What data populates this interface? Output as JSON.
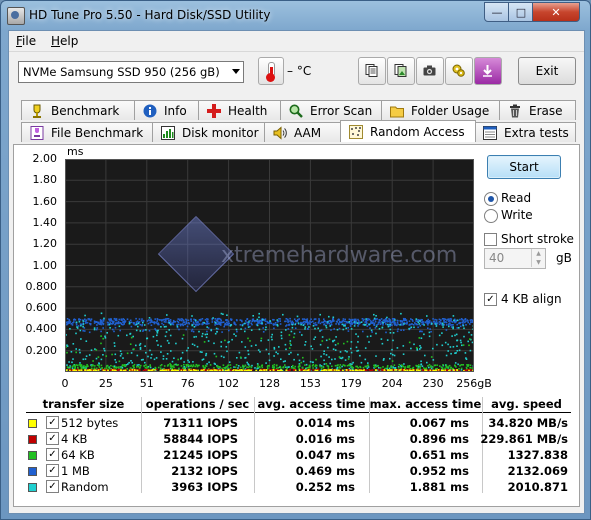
{
  "window": {
    "title": "HD Tune Pro 5.50 - Hard Disk/SSD Utility"
  },
  "menu": [
    {
      "label": "File",
      "underline": "F",
      "rest": "ile"
    },
    {
      "label": "Help",
      "underline": "H",
      "rest": "elp"
    }
  ],
  "toolbar": {
    "drive": "NVMe    Samsung SSD 950 (256 gB)",
    "temperature": "– °C",
    "exit_label": "Exit",
    "buttons": [
      "copy-text-icon",
      "copy-screenshot-icon",
      "camera-icon",
      "options-icon",
      "save-icon"
    ]
  },
  "tabs_row1": [
    "Benchmark",
    "Info",
    "Health",
    "Error Scan",
    "Folder Usage",
    "Erase"
  ],
  "tabs_row2": [
    "File Benchmark",
    "Disk monitor",
    "AAM",
    "Random Access",
    "Extra tests"
  ],
  "active_tab": "Random Access",
  "graph": {
    "y_unit": "ms",
    "y_ticks": [
      "2.00",
      "1.80",
      "1.60",
      "1.40",
      "1.20",
      "1.00",
      "0.800",
      "0.600",
      "0.400",
      "0.200"
    ],
    "x_ticks": [
      "0",
      "25",
      "51",
      "76",
      "102",
      "128",
      "153",
      "179",
      "204",
      "230",
      "256gB"
    ],
    "watermark": "xtremehardware.com"
  },
  "controls": {
    "start_label": "Start",
    "read_label": "Read",
    "write_label": "Write",
    "short_stroke_label": "Short stroke",
    "short_stroke_value": "40",
    "short_stroke_unit": "gB",
    "align_label": "4 KB align",
    "read_selected": true,
    "short_stroke_checked": false,
    "align_checked": true
  },
  "results": {
    "headers": [
      "transfer size",
      "operations / sec",
      "avg. access time",
      "max. access time",
      "avg. speed"
    ],
    "rows": [
      {
        "size": "512 bytes",
        "color": "#ffff00",
        "ops": "71311 IOPS",
        "avg": "0.014 ms",
        "max": "0.067 ms",
        "speed": "34.820 MB/s"
      },
      {
        "size": "4 KB",
        "color": "#c00000",
        "ops": "58844 IOPS",
        "avg": "0.016 ms",
        "max": "0.896 ms",
        "speed": "229.861 MB/s"
      },
      {
        "size": "64 KB",
        "color": "#22c022",
        "ops": "21245 IOPS",
        "avg": "0.047 ms",
        "max": "0.651 ms",
        "speed": "1327.838"
      },
      {
        "size": "1 MB",
        "color": "#2060d0",
        "ops": "2132 IOPS",
        "avg": "0.469 ms",
        "max": "0.952 ms",
        "speed": "2132.069"
      },
      {
        "size": "Random",
        "color": "#20d0d0",
        "ops": "3963 IOPS",
        "avg": "0.252 ms",
        "max": "1.881 ms",
        "speed": "2010.871"
      }
    ]
  },
  "chart_data": {
    "type": "scatter",
    "ylabel": "ms",
    "ylim": [
      0,
      2.0
    ],
    "xlim": [
      0,
      256
    ],
    "x_unit": "gB",
    "series": [
      {
        "name": "512 bytes",
        "color": "#ffff00",
        "y_mean": 0.014,
        "y_max": 0.067
      },
      {
        "name": "4 KB",
        "color": "#c00000",
        "y_mean": 0.016,
        "y_max": 0.896
      },
      {
        "name": "64 KB",
        "color": "#22c022",
        "y_mean": 0.047,
        "y_max": 0.651
      },
      {
        "name": "1 MB",
        "color": "#2060d0",
        "y_mean": 0.469,
        "y_max": 0.952
      },
      {
        "name": "Random",
        "color": "#20d0d0",
        "y_mean": 0.252,
        "y_max": 1.881
      }
    ]
  }
}
